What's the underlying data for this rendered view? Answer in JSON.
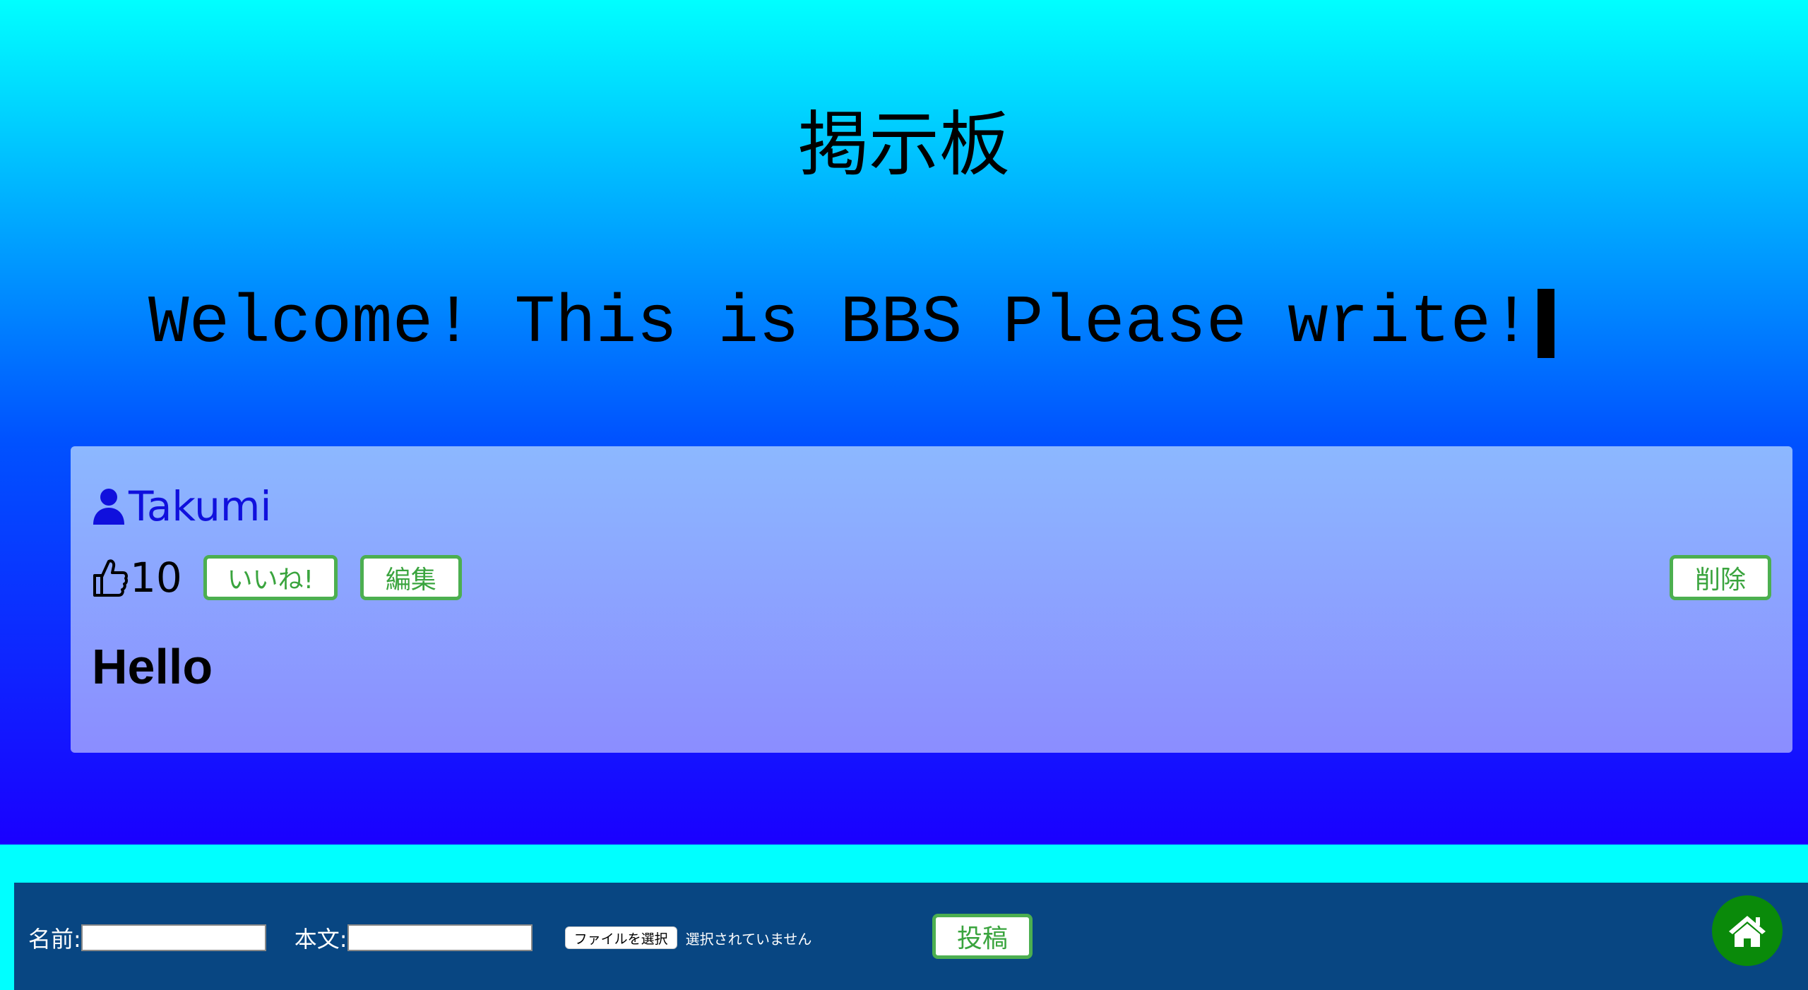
{
  "header": {
    "title": "掲示板",
    "welcome_text": "Welcome! This is BBS Please write!"
  },
  "posts": [
    {
      "author": "Takumi",
      "author_icon": "user-icon",
      "likes": "10",
      "like_icon": "thumbs-up-icon",
      "like_label": "いいね!",
      "edit_label": "編集",
      "delete_label": "削除",
      "body": "Hello"
    }
  ],
  "form": {
    "name_label": "名前:",
    "name_value": "",
    "body_label": "本文:",
    "body_value": "",
    "file_button_label": "ファイルを選択",
    "file_status": "選択されていません",
    "submit_label": "投稿",
    "home_icon": "home-icon"
  },
  "colors": {
    "accent_green": "#4caf50",
    "footer_bg": "#084682",
    "author_blue": "#1010dd",
    "home_button": "#0a8a0a"
  }
}
